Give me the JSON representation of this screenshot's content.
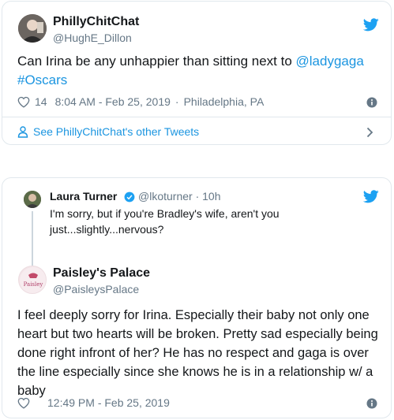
{
  "tweet1": {
    "name": "PhillyChitChat",
    "handle": "@HughE_Dillon",
    "text_before": "Can Irina be any unhappier than sitting next to ",
    "mention": "@ladygaga",
    "hashtag": "#Oscars",
    "likes": "14",
    "timestamp": "8:04 AM - Feb 25, 2019",
    "location_sep": "·",
    "location": "Philadelphia, PA",
    "see_more": "See PhillyChitChat's other Tweets"
  },
  "tweet2": {
    "parent": {
      "name": "Laura Turner",
      "handle": "@lkoturner",
      "sep": "·",
      "time": "10h",
      "text_line1": "I'm sorry, but if you're Bradley's wife, aren't you",
      "text_line2": "just...slightly...nervous?"
    },
    "name": "Paisley's Palace",
    "handle": "@PaisleysPalace",
    "text_lines": [
      "I feel deeply sorry for Irina. Especially their baby not only one",
      "heart but two hearts will be broken. Pretty sad especially being",
      "done right infront of her? He has no respect and gaga is over",
      "the line especially since she knows he is in a relationship w/ a",
      "baby"
    ],
    "timestamp": "12:49 PM - Feb 25, 2019"
  },
  "colors": {
    "brand_blue": "#1da1f2",
    "link_blue": "#1b95e0",
    "muted": "#657786",
    "border": "#e1e8ed"
  }
}
